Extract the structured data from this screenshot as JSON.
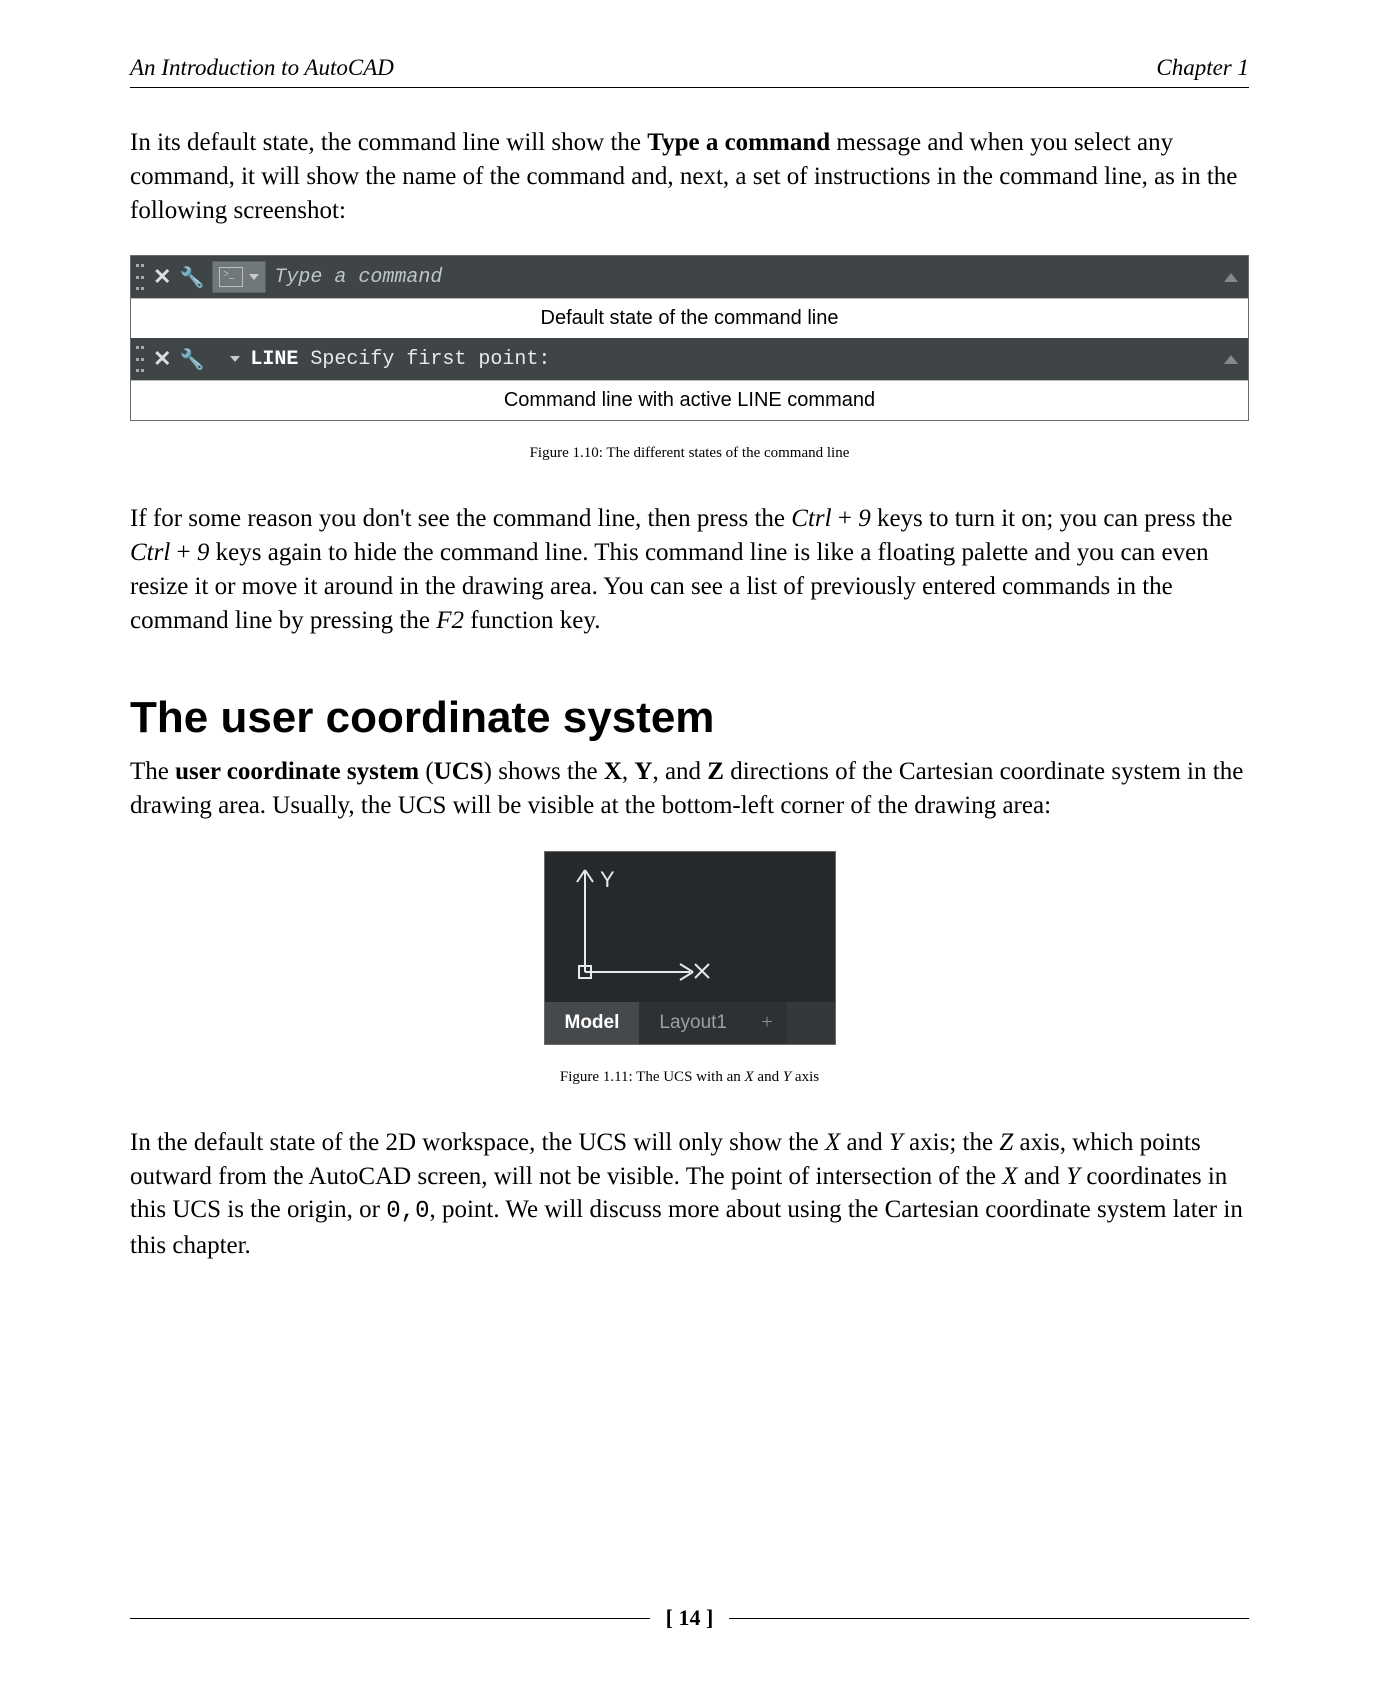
{
  "header": {
    "left": "An Introduction to AutoCAD",
    "right": "Chapter 1"
  },
  "para1_parts": {
    "a": "In its default state, the command line will show the ",
    "bold1": "Type a command",
    "b": " message and when you select any command, it will show the name of the command and, next, a set of instructions in the command line, as in the following screenshot:"
  },
  "fig1": {
    "placeholder": "Type a command",
    "label_default": "Default state of the command line",
    "line_cmd_prefix": "LINE",
    "line_cmd_rest": " Specify first point:",
    "label_active": "Command line with active LINE command",
    "caption": "Figure 1.10: The different states of the command line"
  },
  "para2_parts": {
    "a": "If for some reason you don't see the command line, then press the ",
    "i1": "Ctrl",
    "plus1": " + ",
    "i2": "9",
    "b": " keys to turn it on; you can press the ",
    "i3": "Ctrl",
    "plus2": " + ",
    "i4": "9",
    "c": " keys again to hide the command line. This command line is like a floating palette and you can even resize it or move it around in the drawing area. You can see a list of previously entered commands in the command line by pressing the ",
    "i5": "F2",
    "d": " function key."
  },
  "section_heading": "The user coordinate system",
  "para3_parts": {
    "a": "The ",
    "b1": "user coordinate system",
    "b": " (",
    "b2": "UCS",
    "c": ") shows the ",
    "b3": "X",
    "d": ", ",
    "b4": "Y",
    "e": ", and ",
    "b5": "Z",
    "f": " directions of the Cartesian coordinate system in the drawing area. Usually, the UCS will be visible at the bottom-left corner of the drawing area:"
  },
  "fig2": {
    "y_label": "Y",
    "x_label": "X",
    "tab_model": "Model",
    "tab_layout": "Layout1",
    "plus": "+",
    "caption_a": "Figure 1.11: The  UCS with an ",
    "caption_i1": "X",
    "caption_b": " and ",
    "caption_i2": "Y",
    "caption_c": " axis"
  },
  "para4_parts": {
    "a": "In the default state of the 2D workspace, the UCS will only show the ",
    "i1": "X",
    "b": " and ",
    "i2": "Y",
    "c": " axis; the ",
    "i3": "Z",
    "d": " axis, which points outward from the AutoCAD screen, will not be visible. The point of intersection of the ",
    "i4": "X",
    "e": " and ",
    "i5": "Y",
    "f": " coordinates in this UCS is the origin, or ",
    "mono": "0,0",
    "g": ", point. We will discuss more about using the Cartesian coordinate system later in this chapter."
  },
  "page_number": "[ 14 ]"
}
